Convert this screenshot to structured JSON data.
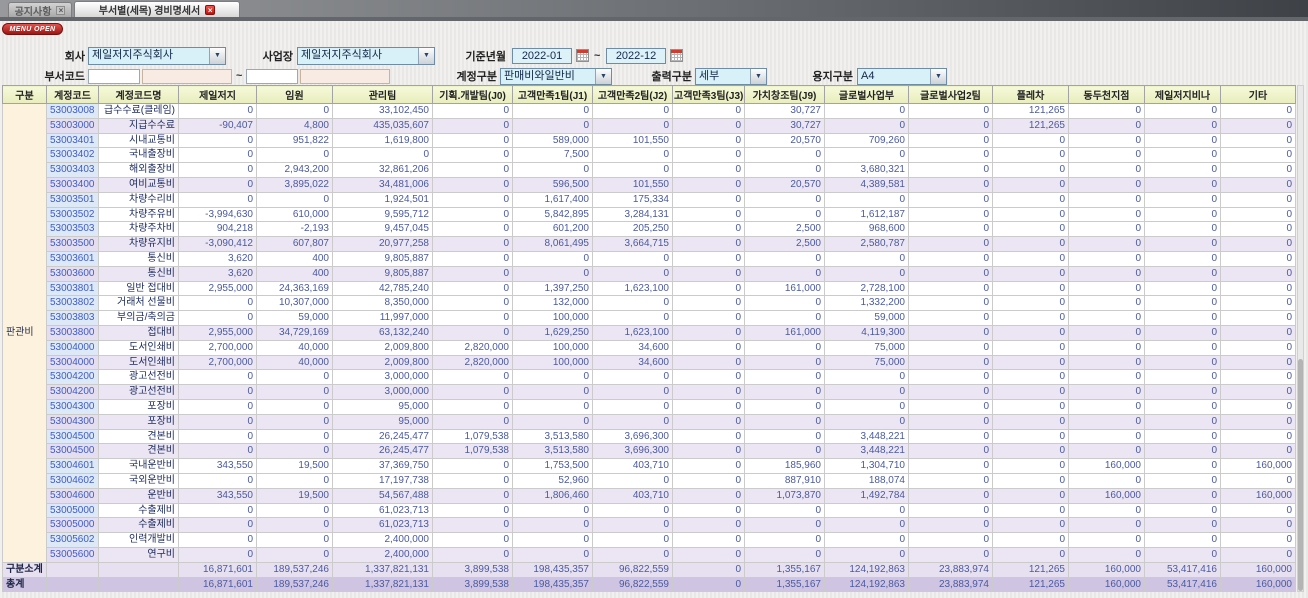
{
  "tabs": [
    {
      "label": "공지사항"
    },
    {
      "label": "부서별(세목) 경비명세서"
    }
  ],
  "menu_open_label": "MENU OPEN",
  "filters": {
    "company_label": "회사",
    "company_value": "제일저지주식회사",
    "workplace_label": "사업장",
    "workplace_value": "제일저지주식회사",
    "period_label": "기준년월",
    "period_from": "2022-01",
    "period_to": "2022-12",
    "tilde": "~",
    "dept_code_label": "부서코드",
    "account_type_label": "계정구분",
    "account_type_value": "판매비와일반비",
    "output_type_label": "출력구분",
    "output_type_value": "세부",
    "paper_type_label": "용지구분",
    "paper_type_value": "A4"
  },
  "colors": {
    "menu_open_red": "#b01712",
    "tab_close_red": "#cc1510",
    "header_bg": "#eef2c4",
    "subtotal_row_bg": "#ece5f3",
    "footer_subtotal_bg": "#e7e0f1",
    "footer_total_bg": "#cfc5e3",
    "group_cell_bg": "#fdf2dd",
    "code_cell_bg": "#dde9f7",
    "combo_field_bg": "#d8f0f7",
    "dept_input_bg": "#f7ebe3"
  },
  "table": {
    "columns": [
      "구분",
      "계정코드",
      "계정코드명",
      "제일저지",
      "임원",
      "관리팀",
      "기획.개발팀(J0)",
      "고객만족1팀(J1)",
      "고객만족2팀(J2)",
      "고객만족3팀(J3)",
      "가치창조팀(J9)",
      "글로벌사업부",
      "글로벌사업2팀",
      "플레차",
      "동두천지점",
      "제일저지비나",
      "기타"
    ],
    "group_label": "판관비",
    "rows": [
      {
        "code": "53003008",
        "name": "급수수료(클레임)",
        "sub": false,
        "values": [
          "0",
          "0",
          "33,102,450",
          "0",
          "0",
          "0",
          "0",
          "30,727",
          "0",
          "0",
          "121,265",
          "0",
          "0",
          "0"
        ]
      },
      {
        "code": "53003000",
        "name": "지급수수료",
        "sub": true,
        "values": [
          "-90,407",
          "4,800",
          "435,035,607",
          "0",
          "0",
          "0",
          "0",
          "30,727",
          "0",
          "0",
          "121,265",
          "0",
          "0",
          "0"
        ]
      },
      {
        "code": "53003401",
        "name": "시내교통비",
        "sub": false,
        "values": [
          "0",
          "951,822",
          "1,619,800",
          "0",
          "589,000",
          "101,550",
          "0",
          "20,570",
          "709,260",
          "0",
          "0",
          "0",
          "0",
          "0"
        ]
      },
      {
        "code": "53003402",
        "name": "국내출장비",
        "sub": false,
        "values": [
          "0",
          "0",
          "0",
          "0",
          "7,500",
          "0",
          "0",
          "0",
          "0",
          "0",
          "0",
          "0",
          "0",
          "0"
        ]
      },
      {
        "code": "53003403",
        "name": "해외출장비",
        "sub": false,
        "values": [
          "0",
          "2,943,200",
          "32,861,206",
          "0",
          "0",
          "0",
          "0",
          "0",
          "3,680,321",
          "0",
          "0",
          "0",
          "0",
          "0"
        ]
      },
      {
        "code": "53003400",
        "name": "여비교통비",
        "sub": true,
        "values": [
          "0",
          "3,895,022",
          "34,481,006",
          "0",
          "596,500",
          "101,550",
          "0",
          "20,570",
          "4,389,581",
          "0",
          "0",
          "0",
          "0",
          "0"
        ]
      },
      {
        "code": "53003501",
        "name": "차량수리비",
        "sub": false,
        "values": [
          "0",
          "0",
          "1,924,501",
          "0",
          "1,617,400",
          "175,334",
          "0",
          "0",
          "0",
          "0",
          "0",
          "0",
          "0",
          "0"
        ]
      },
      {
        "code": "53003502",
        "name": "차량주유비",
        "sub": false,
        "values": [
          "-3,994,630",
          "610,000",
          "9,595,712",
          "0",
          "5,842,895",
          "3,284,131",
          "0",
          "0",
          "1,612,187",
          "0",
          "0",
          "0",
          "0",
          "0"
        ]
      },
      {
        "code": "53003503",
        "name": "차량주차비",
        "sub": false,
        "values": [
          "904,218",
          "-2,193",
          "9,457,045",
          "0",
          "601,200",
          "205,250",
          "0",
          "2,500",
          "968,600",
          "0",
          "0",
          "0",
          "0",
          "0"
        ]
      },
      {
        "code": "53003500",
        "name": "차량유지비",
        "sub": true,
        "values": [
          "-3,090,412",
          "607,807",
          "20,977,258",
          "0",
          "8,061,495",
          "3,664,715",
          "0",
          "2,500",
          "2,580,787",
          "0",
          "0",
          "0",
          "0",
          "0"
        ]
      },
      {
        "code": "53003601",
        "name": "통신비",
        "sub": false,
        "values": [
          "3,620",
          "400",
          "9,805,887",
          "0",
          "0",
          "0",
          "0",
          "0",
          "0",
          "0",
          "0",
          "0",
          "0",
          "0"
        ]
      },
      {
        "code": "53003600",
        "name": "통신비",
        "sub": true,
        "values": [
          "3,620",
          "400",
          "9,805,887",
          "0",
          "0",
          "0",
          "0",
          "0",
          "0",
          "0",
          "0",
          "0",
          "0",
          "0"
        ]
      },
      {
        "code": "53003801",
        "name": "일반 접대비",
        "sub": false,
        "values": [
          "2,955,000",
          "24,363,169",
          "42,785,240",
          "0",
          "1,397,250",
          "1,623,100",
          "0",
          "161,000",
          "2,728,100",
          "0",
          "0",
          "0",
          "0",
          "0"
        ]
      },
      {
        "code": "53003802",
        "name": "거래처 선물비",
        "sub": false,
        "values": [
          "0",
          "10,307,000",
          "8,350,000",
          "0",
          "132,000",
          "0",
          "0",
          "0",
          "1,332,200",
          "0",
          "0",
          "0",
          "0",
          "0"
        ]
      },
      {
        "code": "53003803",
        "name": "부의금/축의금",
        "sub": false,
        "values": [
          "0",
          "59,000",
          "11,997,000",
          "0",
          "100,000",
          "0",
          "0",
          "0",
          "59,000",
          "0",
          "0",
          "0",
          "0",
          "0"
        ]
      },
      {
        "code": "53003800",
        "name": "접대비",
        "sub": true,
        "values": [
          "2,955,000",
          "34,729,169",
          "63,132,240",
          "0",
          "1,629,250",
          "1,623,100",
          "0",
          "161,000",
          "4,119,300",
          "0",
          "0",
          "0",
          "0",
          "0"
        ]
      },
      {
        "code": "53004000",
        "name": "도서인쇄비",
        "sub": false,
        "values": [
          "2,700,000",
          "40,000",
          "2,009,800",
          "2,820,000",
          "100,000",
          "34,600",
          "0",
          "0",
          "75,000",
          "0",
          "0",
          "0",
          "0",
          "0"
        ]
      },
      {
        "code": "53004000",
        "name": "도서인쇄비",
        "sub": true,
        "values": [
          "2,700,000",
          "40,000",
          "2,009,800",
          "2,820,000",
          "100,000",
          "34,600",
          "0",
          "0",
          "75,000",
          "0",
          "0",
          "0",
          "0",
          "0"
        ]
      },
      {
        "code": "53004200",
        "name": "광고선전비",
        "sub": false,
        "values": [
          "0",
          "0",
          "3,000,000",
          "0",
          "0",
          "0",
          "0",
          "0",
          "0",
          "0",
          "0",
          "0",
          "0",
          "0"
        ]
      },
      {
        "code": "53004200",
        "name": "광고선전비",
        "sub": true,
        "values": [
          "0",
          "0",
          "3,000,000",
          "0",
          "0",
          "0",
          "0",
          "0",
          "0",
          "0",
          "0",
          "0",
          "0",
          "0"
        ]
      },
      {
        "code": "53004300",
        "name": "포장비",
        "sub": false,
        "values": [
          "0",
          "0",
          "95,000",
          "0",
          "0",
          "0",
          "0",
          "0",
          "0",
          "0",
          "0",
          "0",
          "0",
          "0"
        ]
      },
      {
        "code": "53004300",
        "name": "포장비",
        "sub": true,
        "values": [
          "0",
          "0",
          "95,000",
          "0",
          "0",
          "0",
          "0",
          "0",
          "0",
          "0",
          "0",
          "0",
          "0",
          "0"
        ]
      },
      {
        "code": "53004500",
        "name": "견본비",
        "sub": false,
        "values": [
          "0",
          "0",
          "26,245,477",
          "1,079,538",
          "3,513,580",
          "3,696,300",
          "0",
          "0",
          "3,448,221",
          "0",
          "0",
          "0",
          "0",
          "0"
        ]
      },
      {
        "code": "53004500",
        "name": "견본비",
        "sub": true,
        "values": [
          "0",
          "0",
          "26,245,477",
          "1,079,538",
          "3,513,580",
          "3,696,300",
          "0",
          "0",
          "3,448,221",
          "0",
          "0",
          "0",
          "0",
          "0"
        ]
      },
      {
        "code": "53004601",
        "name": "국내운반비",
        "sub": false,
        "values": [
          "343,550",
          "19,500",
          "37,369,750",
          "0",
          "1,753,500",
          "403,710",
          "0",
          "185,960",
          "1,304,710",
          "0",
          "0",
          "160,000",
          "0",
          "160,000"
        ]
      },
      {
        "code": "53004602",
        "name": "국외운반비",
        "sub": false,
        "values": [
          "0",
          "0",
          "17,197,738",
          "0",
          "52,960",
          "0",
          "0",
          "887,910",
          "188,074",
          "0",
          "0",
          "0",
          "0",
          "0"
        ]
      },
      {
        "code": "53004600",
        "name": "운반비",
        "sub": true,
        "values": [
          "343,550",
          "19,500",
          "54,567,488",
          "0",
          "1,806,460",
          "403,710",
          "0",
          "1,073,870",
          "1,492,784",
          "0",
          "0",
          "160,000",
          "0",
          "160,000"
        ]
      },
      {
        "code": "53005000",
        "name": "수출제비",
        "sub": false,
        "values": [
          "0",
          "0",
          "61,023,713",
          "0",
          "0",
          "0",
          "0",
          "0",
          "0",
          "0",
          "0",
          "0",
          "0",
          "0"
        ]
      },
      {
        "code": "53005000",
        "name": "수출제비",
        "sub": true,
        "values": [
          "0",
          "0",
          "61,023,713",
          "0",
          "0",
          "0",
          "0",
          "0",
          "0",
          "0",
          "0",
          "0",
          "0",
          "0"
        ]
      },
      {
        "code": "53005602",
        "name": "인력개발비",
        "sub": false,
        "values": [
          "0",
          "0",
          "2,400,000",
          "0",
          "0",
          "0",
          "0",
          "0",
          "0",
          "0",
          "0",
          "0",
          "0",
          "0"
        ]
      },
      {
        "code": "53005600",
        "name": "연구비",
        "sub": true,
        "values": [
          "0",
          "0",
          "2,400,000",
          "0",
          "0",
          "0",
          "0",
          "0",
          "0",
          "0",
          "0",
          "0",
          "0",
          "0"
        ]
      }
    ],
    "footer": [
      {
        "label": "구분소계",
        "values": [
          "16,871,601",
          "189,537,246",
          "1,337,821,131",
          "3,899,538",
          "198,435,357",
          "96,822,559",
          "0",
          "1,355,167",
          "124,192,863",
          "23,883,974",
          "121,265",
          "160,000",
          "53,417,416",
          "160,000"
        ]
      },
      {
        "label": "총계",
        "values": [
          "16,871,601",
          "189,537,246",
          "1,337,821,131",
          "3,899,538",
          "198,435,357",
          "96,822,559",
          "0",
          "1,355,167",
          "124,192,863",
          "23,883,974",
          "121,265",
          "160,000",
          "53,417,416",
          "160,000"
        ]
      }
    ]
  }
}
